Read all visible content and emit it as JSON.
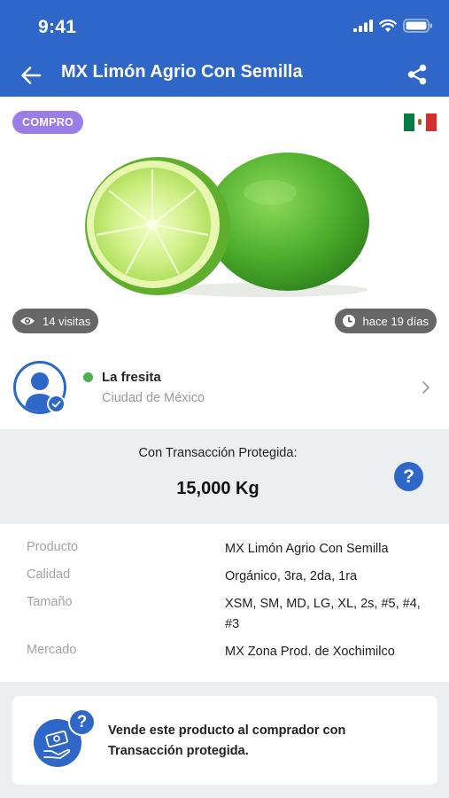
{
  "status_bar": {
    "time": "9:41"
  },
  "nav": {
    "title": "MX Limón Agrio Con Semilla",
    "back_icon": "arrow-left-icon",
    "share_icon": "share-icon"
  },
  "listing": {
    "badge": "COMPRO",
    "badge_color": "#9a7de6",
    "flag": "mexico-flag",
    "views": "14 visitas",
    "age": "hace 19 días"
  },
  "seller": {
    "name": "La fresita",
    "city": "Ciudad de México",
    "status_color": "#4caf50"
  },
  "protected": {
    "label": "Con Transacción Protegida:",
    "quantity": "15,000 Kg",
    "help_symbol": "?"
  },
  "details": [
    {
      "label": "Producto",
      "value": "MX Limón Agrio Con Semilla"
    },
    {
      "label": "Calidad",
      "value": "Orgánico, 3ra, 2da, 1ra"
    },
    {
      "label": "Tamaño",
      "value": "XSM, SM, MD, LG, XL, 2s, #5, #4, #3"
    },
    {
      "label": "Mercado",
      "value": "MX Zona Prod. de Xochimilco"
    }
  ],
  "sell_card": {
    "text": "Vende este producto al comprador con Transacción protegida.",
    "help_symbol": "?"
  },
  "colors": {
    "primary": "#2f67c8",
    "background_gray": "#eceef1"
  }
}
